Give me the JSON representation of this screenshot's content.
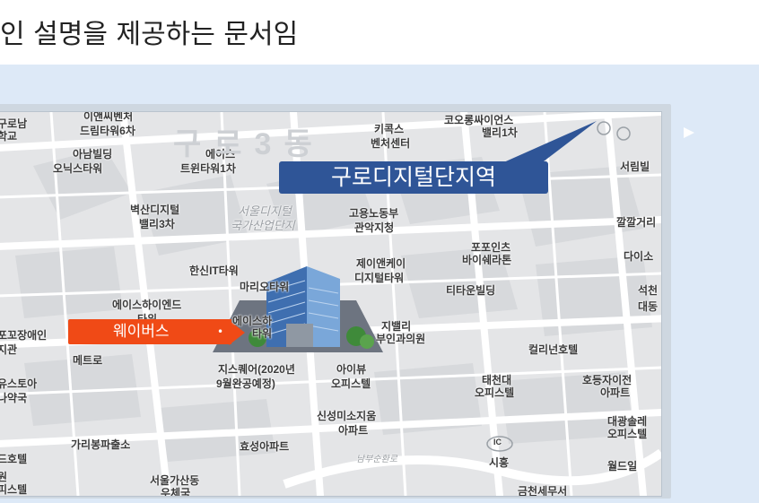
{
  "heading": "인 설명을 제공하는 문서임",
  "callouts": {
    "station": "구로디지털단지역",
    "company": "웨이버스"
  },
  "colors": {
    "panel": "#dde9f7",
    "station_callout": "#2f5597",
    "company_callout": "#f04a16"
  },
  "map_labels": {
    "l1": "구로남",
    "l2": "학교",
    "l3": "이앤씨벤처",
    "l4": "드림타워6차",
    "l5": "아남빌딩",
    "l6": "오닉스타워",
    "l7": "에이스",
    "l8": "트윈타워1차",
    "l9": "구로3동",
    "l10": "키콕스",
    "l11": "벤처센터",
    "l12": "코오롱싸이언스",
    "l13": "밸리1차",
    "l14": "서림빌",
    "l15": "벽산디지털",
    "l16": "밸리3차",
    "l17": "서울디지털",
    "l18": "국가산업단지",
    "l19": "고용노동부",
    "l20": "관악지청",
    "l21": "깔깔거리",
    "l22": "포포인츠",
    "l23": "바이쉐라톤",
    "l24": "다이소",
    "l25": "한신IT타워",
    "l26": "마리오타워",
    "l27": "제이앤케이",
    "l28": "디지털타워",
    "l29": "티타운빌딩",
    "l30": "석천",
    "l31": "대동",
    "l32": "에이스하이엔드",
    "l33": "타워",
    "l34": "에이스하",
    "l35": "타워",
    "l36": "지밸리",
    "l37": "부인과의원",
    "l38": "컬리넌호텔",
    "l39": "포꼬장애인",
    "l40": "지관",
    "l41": "메트로",
    "l42": "지스퀘어(2020년",
    "l43": "9월완공예정)",
    "l44": "아이뷰",
    "l45": "오피스텔",
    "l46": "태천대",
    "l47": "오피스텔",
    "l48": "호등자이전",
    "l49": "아파트",
    "l50": "유스토아",
    "l51": "나약국",
    "l52": "신성미소지움",
    "l53": "아파트",
    "l54": "대광솔레",
    "l55": "오피스텔",
    "l56": "가리봉파출소",
    "l57": "효성아파트",
    "l58": "IC",
    "l59": "시흥",
    "l60": "월드일",
    "l61": "드호텔",
    "l62": "원",
    "l63": "피스텔",
    "l64": "서울가산동",
    "l65": "우체국",
    "l66": "금천세무서",
    "l67": "남부순환로"
  }
}
